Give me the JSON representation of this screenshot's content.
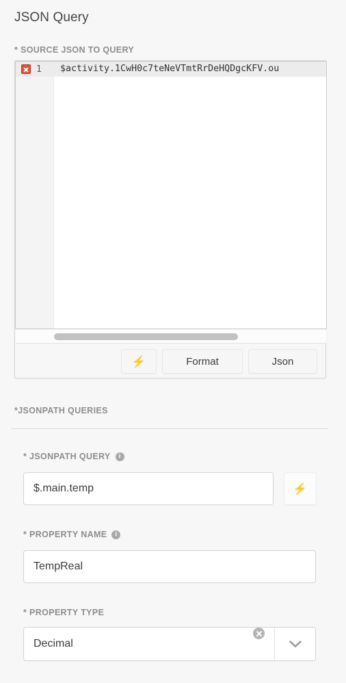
{
  "panel": {
    "title": "JSON Query"
  },
  "source_section": {
    "label": "* SOURCE JSON TO QUERY",
    "editor": {
      "line_number": "1",
      "error_icon": "error-x-icon",
      "code": "$activity.1CwH0c7teNeVTmtRrDeHQDgcKFV.ou",
      "scrollbar": "horizontal-scrollbar"
    },
    "buttons": {
      "bolt_icon": "lightning-bolt-icon",
      "bolt_label": "⚡",
      "format_label": "Format",
      "json_label": "Json"
    }
  },
  "queries_section": {
    "label": "*JSONPATH QUERIES"
  },
  "jsonpath_query": {
    "label": "* JSONPATH QUERY",
    "info_icon": "info-icon",
    "info_char": "i",
    "value": "$.main.temp",
    "placeholder": "",
    "bolt_label": "⚡"
  },
  "property_name": {
    "label": "* PROPERTY NAME",
    "info_icon": "info-icon",
    "info_char": "i",
    "value": "TempReal",
    "placeholder": ""
  },
  "property_type": {
    "label": "* PROPERTY TYPE",
    "value": "Decimal",
    "clear_icon": "clear-circle-icon",
    "chevron_icon": "chevron-down-icon",
    "options": [
      "Decimal"
    ]
  },
  "colors": {
    "page_background": "#f7f7f7",
    "error_red": "#e2503a",
    "label_gray": "#8d8d8d",
    "text_dark": "#3c3c3c",
    "border_gray": "#d3d3d3"
  }
}
